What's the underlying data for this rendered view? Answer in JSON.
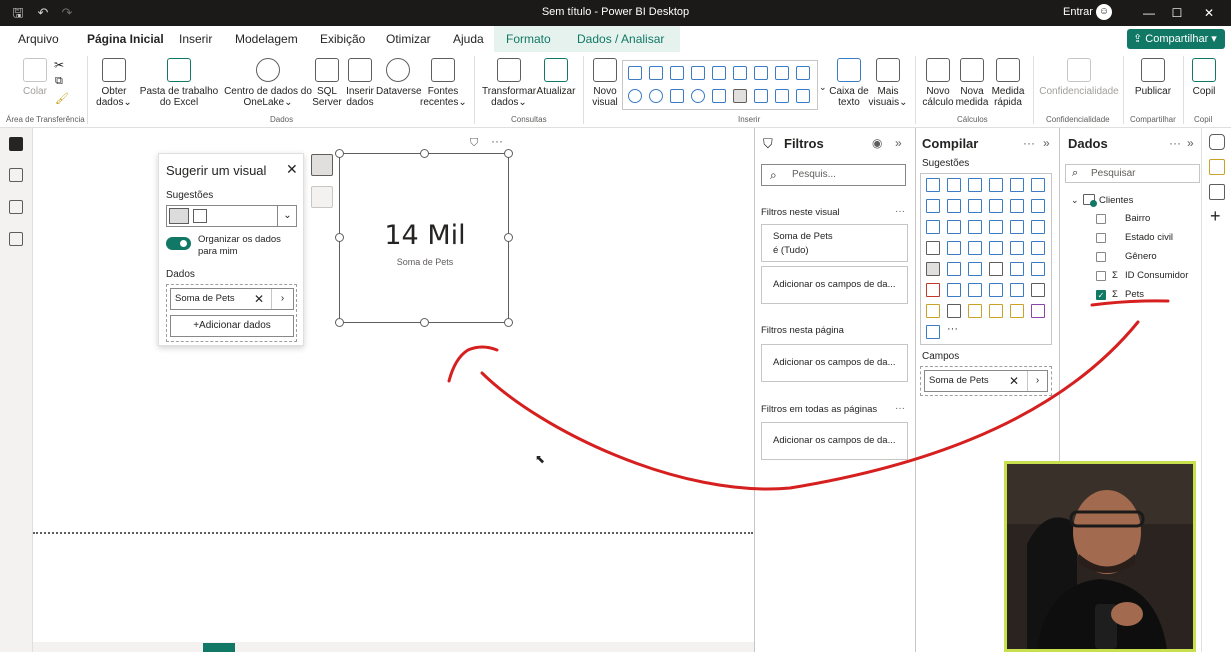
{
  "window": {
    "title": "Sem título - Power BI Desktop",
    "signin": "Entrar"
  },
  "menu": {
    "tabs": [
      "Arquivo",
      "Página Inicial",
      "Inserir",
      "Modelagem",
      "Exibição",
      "Otimizar",
      "Ajuda",
      "Formato",
      "Dados / Analisar"
    ],
    "active": "Página Inicial",
    "share": "Compartilhar"
  },
  "ribbon": {
    "paste": "Colar",
    "get_data": "Obter dados",
    "excel": "Pasta de trabalho do Excel",
    "onelake": "Centro de dados do OneLake",
    "sql": "SQL Server",
    "insert_data": "Inserir dados",
    "dataverse": "Dataverse",
    "recent": "Fontes recentes",
    "transform": "Transformar dados",
    "refresh": "Atualizar",
    "new_visual": "Novo visual",
    "textbox": "Caixa de texto",
    "more_visuals": "Mais visuais",
    "new_calc": "Novo cálculo",
    "new_measure": "Nova medida",
    "quick_measure": "Medida rápida",
    "sensitivity": "Confidencialidade",
    "publish": "Publicar",
    "copilot": "Copil",
    "groups": {
      "clipboard": "Área de Transferência",
      "data": "Dados",
      "queries": "Consultas",
      "insert": "Inserir",
      "calculations": "Cálculos",
      "sensitivity": "Confidencialidade",
      "share": "Compartilhar",
      "copilot": "Copil"
    }
  },
  "suggest": {
    "title": "Sugerir um visual",
    "suggestions_label": "Sugestões",
    "toggle_label": "Organizar os dados para mim",
    "data_label": "Dados",
    "field": "Soma de Pets",
    "add_button": "+Adicionar dados"
  },
  "card": {
    "value": "14 Mil",
    "caption": "Soma de Pets"
  },
  "filters": {
    "title": "Filtros",
    "search_placeholder": "Pesquis...",
    "visual_section": "Filtros neste visual",
    "visual_filter_name": "Soma de Pets",
    "visual_filter_value": "é (Tudo)",
    "add_fields": "Adicionar os campos de da...",
    "page_section": "Filtros nesta página",
    "all_section": "Filtros em todas as páginas"
  },
  "build": {
    "title": "Compilar",
    "suggestions": "Sugestões",
    "fields_label": "Campos",
    "field": "Soma de Pets"
  },
  "data": {
    "title": "Dados",
    "search_placeholder": "Pesquisar",
    "table": "Clientes",
    "fields": [
      {
        "name": "Bairro",
        "sigma": "",
        "checked": false
      },
      {
        "name": "Estado civil",
        "sigma": "",
        "checked": false
      },
      {
        "name": "Gênero",
        "sigma": "",
        "checked": false
      },
      {
        "name": "ID Consumidor",
        "sigma": "Σ",
        "checked": false
      },
      {
        "name": "Pets",
        "sigma": "Σ",
        "checked": true
      }
    ]
  },
  "colors": {
    "accent": "#117865",
    "annotation": "#d61f1f",
    "webcam_border": "#c8e04e"
  }
}
